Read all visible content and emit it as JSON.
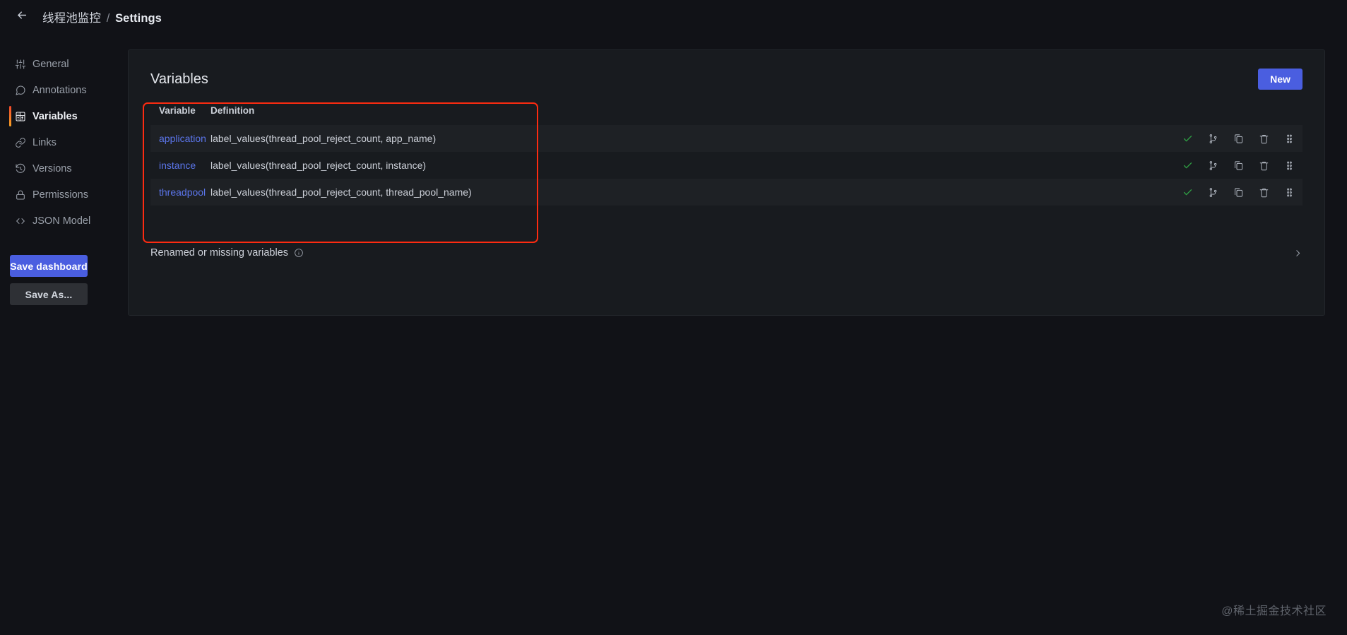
{
  "header": {
    "back_icon": "arrow-left-icon",
    "dashboard_name": "线程池监控",
    "separator": "/",
    "page": "Settings"
  },
  "sidebar": {
    "items": [
      {
        "label": "General",
        "icon": "sliders-icon",
        "active": false
      },
      {
        "label": "Annotations",
        "icon": "comment-icon",
        "active": false
      },
      {
        "label": "Variables",
        "icon": "calculator-icon",
        "active": true
      },
      {
        "label": "Links",
        "icon": "link-icon",
        "active": false
      },
      {
        "label": "Versions",
        "icon": "history-icon",
        "active": false
      },
      {
        "label": "Permissions",
        "icon": "lock-icon",
        "active": false
      },
      {
        "label": "JSON Model",
        "icon": "code-icon",
        "active": false
      }
    ],
    "save_dashboard_label": "Save dashboard",
    "save_as_label": "Save As..."
  },
  "main": {
    "title": "Variables",
    "new_button_label": "New",
    "table": {
      "columns": [
        "Variable",
        "Definition"
      ],
      "rows": [
        {
          "variable": "application",
          "definition": "label_values(thread_pool_reject_count, app_name)"
        },
        {
          "variable": "instance",
          "definition": "label_values(thread_pool_reject_count, instance)"
        },
        {
          "variable": "threadpool",
          "definition": "label_values(thread_pool_reject_count, thread_pool_name)"
        }
      ],
      "row_actions": [
        {
          "name": "enabled-check-icon",
          "title": "Variable is referenced"
        },
        {
          "name": "code-branch-icon",
          "title": "Show usages"
        },
        {
          "name": "duplicate-icon",
          "title": "Duplicate variable"
        },
        {
          "name": "trash-icon",
          "title": "Remove variable"
        },
        {
          "name": "drag-handle-icon",
          "title": "Drag to reorder"
        }
      ]
    },
    "collapse_section": {
      "label": "Renamed or missing variables",
      "info_icon": "info-circle-icon",
      "chevron_icon": "chevron-right-icon",
      "expanded": false
    }
  },
  "watermark": "@稀土掘金技术社区",
  "colors": {
    "accent_blue": "#4a5ee0",
    "link_blue": "#5b75ea",
    "check_green": "#2f9d43",
    "annotation_red": "#fc2b11",
    "active_indicator_start": "#f5482a",
    "active_indicator_end": "#f8a225",
    "page_bg": "#111217",
    "card_bg": "#181b1f"
  }
}
